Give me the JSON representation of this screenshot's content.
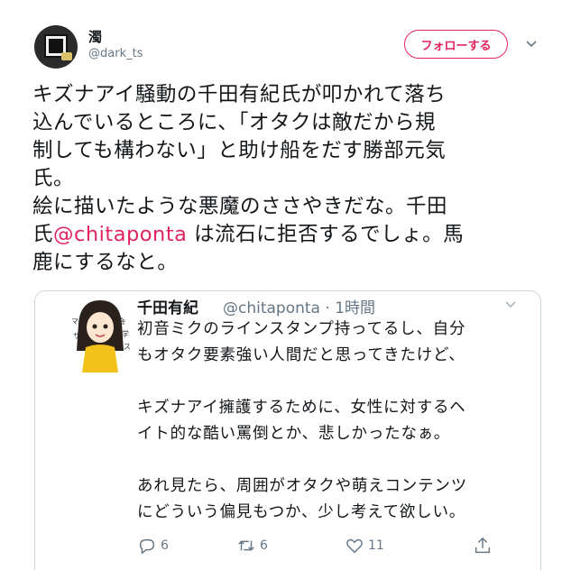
{
  "tweet": {
    "author_name": "濁",
    "author_handle": "@dark_ts",
    "follow_label": "フォローする",
    "body_lines": [
      "キズナアイ騒動の千田有紀氏が叩かれて落ち",
      "込んでいるところに、「オタクは敵だから規",
      "制しても構わない」と助け船をだす勝部元気",
      "氏。",
      "絵に描いたような悪魔のささやきだな。千田"
    ],
    "line6_prefix": "氏",
    "line6_mention": "@chitaponta",
    "line6_suffix": " は流石に拒否するでしょ。馬",
    "line7": "鹿にするなと。"
  },
  "quoted": {
    "author_name": "千田有紀",
    "author_handle": "@chitaponta · 1時間",
    "lines": [
      "初音ミクのラインスタンプ持ってるし、自分",
      "もオタク要素強い人間だと思ってきたけど、",
      "",
      "キズナアイ擁護するために、女性に対するヘ",
      "イト的な酷い罵倒とか、悲しかったなぁ。",
      "",
      "あれ見たら、周囲がオタクや萌えコンテンツ",
      "にどういう偏見もつか、少し考えて欲しい。"
    ],
    "reply_count": "6",
    "retweet_count": "6",
    "like_count": "11"
  },
  "colors": {
    "accent": "#e0245e",
    "muted": "#657786",
    "border": "#ccd6dd"
  }
}
